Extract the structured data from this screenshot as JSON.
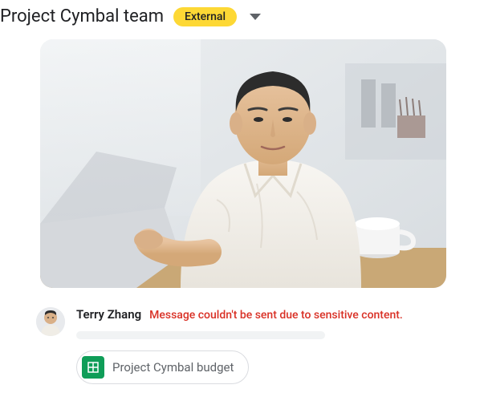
{
  "header": {
    "title": "Project Cymbal team",
    "badge": "External"
  },
  "message": {
    "sender": "Terry Zhang",
    "error": "Message couldn't be sent due to sensitive content."
  },
  "attachment": {
    "label": "Project Cymbal budget",
    "icon_name": "sheets-icon"
  }
}
